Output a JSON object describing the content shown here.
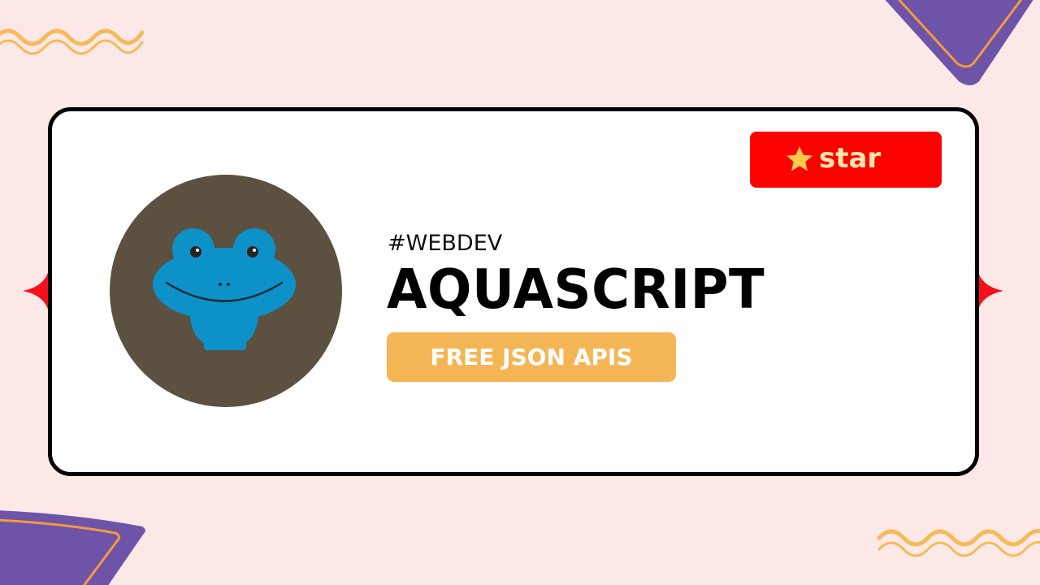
{
  "page": {
    "background_color": "#fde8e8"
  },
  "decorations": {
    "wave_color": "#f5bb58",
    "triangle_color": "#6e54a8",
    "triangle_outline_color": "#f29a3d",
    "sparkle_color": "#f5101b"
  },
  "card": {
    "tag": "#WEBDEV",
    "title": "AQUASCRIPT",
    "badge": {
      "label": "FREE JSON APIS",
      "color": "#f4b654"
    },
    "logo": {
      "icon": "frog-icon",
      "circle_color": "#5c5141",
      "frog_color": "#0c91c9"
    }
  },
  "star_button": {
    "label": "star",
    "icon": "star-icon",
    "color": "#fd0000",
    "text_color": "#ffe7ae",
    "icon_color": "#fbc94d"
  }
}
